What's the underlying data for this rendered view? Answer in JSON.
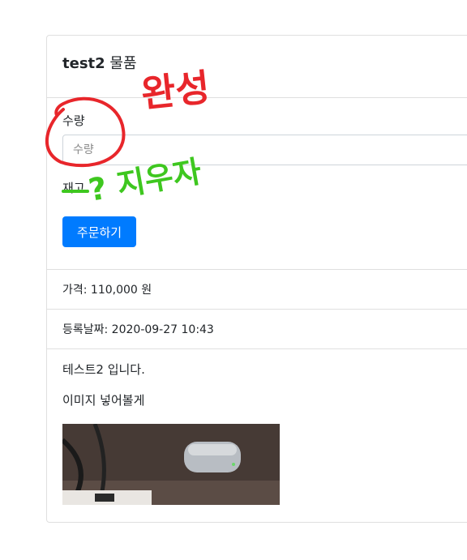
{
  "product": {
    "title_bold": "test2",
    "title_rest": "물품"
  },
  "order_form": {
    "quantity_label": "수량",
    "quantity_placeholder": "수량",
    "stock_label": "재고",
    "order_button": "주문하기"
  },
  "details": {
    "price": "가격: 110,000 원",
    "registered": "등록날짜: 2020-09-27 10:43"
  },
  "description": {
    "line1": "테스트2 입니다.",
    "line2": "이미지 넣어볼게"
  },
  "annotations": {
    "red_text": "완성",
    "green_text": "? 지우자",
    "red_color": "#e8262b",
    "green_color": "#3ec71f"
  }
}
